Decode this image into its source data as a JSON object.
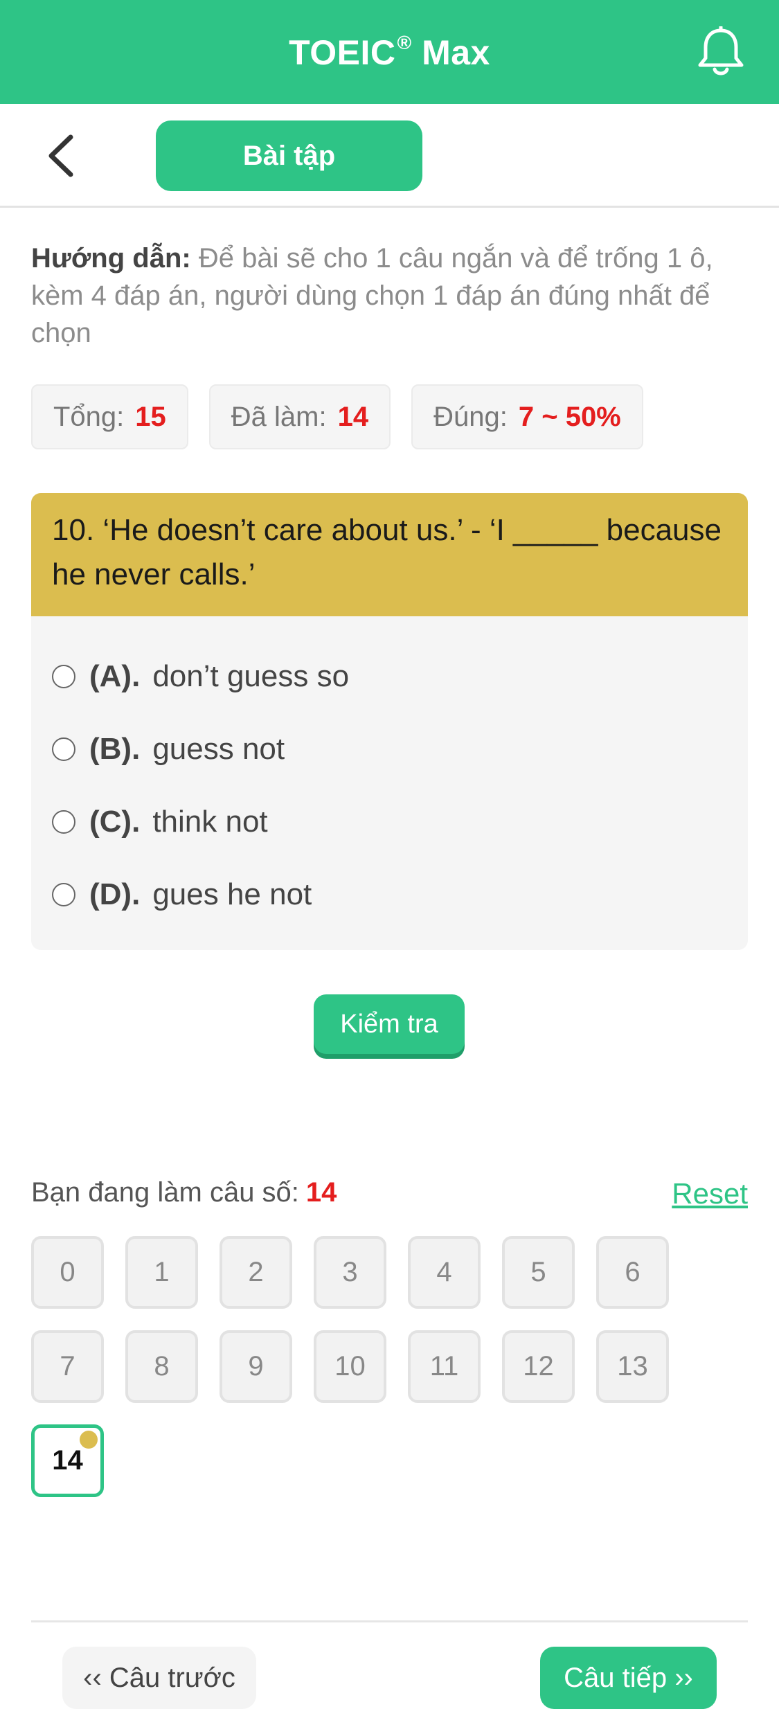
{
  "app": {
    "title": "TOEIC",
    "title_reg": "®",
    "title_suffix": "Max"
  },
  "subbar": {
    "tab_label": "Bài tập"
  },
  "instructions": {
    "label": "Hướng dẫn:",
    "text": "Để bài sẽ cho 1 câu ngắn và để trống 1 ô, kèm 4 đáp án, người dùng chọn 1 đáp án đúng nhất để chọn"
  },
  "stats": {
    "total_label": "Tổng:",
    "total_value": "15",
    "done_label": "Đã làm:",
    "done_value": "14",
    "correct_label": "Đúng:",
    "correct_value": "7 ~ 50%"
  },
  "question": {
    "text": "10. ‘He doesn’t care about us.’ - ‘I _____ because he never calls.’",
    "options": [
      {
        "label": "(A).",
        "text": "don’t guess so"
      },
      {
        "label": "(B).",
        "text": "guess not"
      },
      {
        "label": "(C).",
        "text": "think not"
      },
      {
        "label": "(D).",
        "text": "gues he not"
      }
    ]
  },
  "check_button": "Kiểm tra",
  "progress": {
    "label": "Bạn đang làm câu số:",
    "current": "14",
    "reset": "Reset"
  },
  "question_numbers": [
    "0",
    "1",
    "2",
    "3",
    "4",
    "5",
    "6",
    "7",
    "8",
    "9",
    "10",
    "11",
    "12",
    "13",
    "14"
  ],
  "nav": {
    "prev": "‹‹ Câu trước",
    "next": "Câu tiếp ››"
  },
  "colors": {
    "brand": "#2ec486",
    "question_header": "#dbbd4f",
    "highlight": "#e41e1e"
  }
}
